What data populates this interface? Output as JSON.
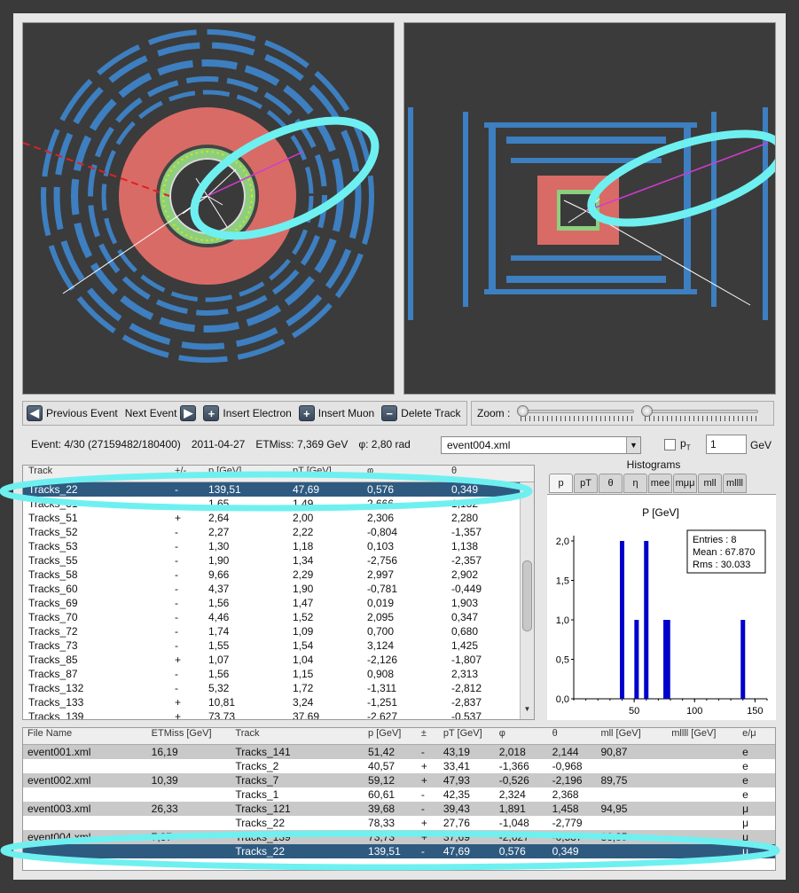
{
  "toolbar": {
    "previous_label": "Previous Event",
    "next_label": "Next Event",
    "insert_electron_label": "Insert Electron",
    "insert_muon_label": "Insert Muon",
    "delete_track_label": "Delete Track",
    "zoom_label": "Zoom :",
    "zoom_levels": [
      0.0,
      0.0
    ]
  },
  "info": {
    "event": "Event: 4/30 (27159482/180400)",
    "date": "2011-04-27",
    "etmiss": "ETMiss: 7,369 GeV",
    "phi": "φ: 2,80 rad",
    "selected_file": "event004.xml",
    "pt_label": "p",
    "pt_sub": "T",
    "pt_value": "1",
    "gev_label": "GeV"
  },
  "tracks_table": {
    "headers": [
      "Track",
      "+/-",
      "p [GeV]",
      "pT [GeV]",
      "φ",
      "θ"
    ],
    "rows": [
      [
        "Tracks_22",
        "-",
        "139,51",
        "47,69",
        "0,576",
        "0,349"
      ],
      [
        "Tracks_31",
        "-",
        "1,65",
        "1,49",
        "2,666",
        "1,132"
      ],
      [
        "Tracks_51",
        "+",
        "2,64",
        "2,00",
        "2,306",
        "2,280"
      ],
      [
        "Tracks_52",
        "-",
        "2,27",
        "2,22",
        "-0,804",
        "-1,357"
      ],
      [
        "Tracks_53",
        "-",
        "1,30",
        "1,18",
        "0,103",
        "1,138"
      ],
      [
        "Tracks_55",
        "-",
        "1,90",
        "1,34",
        "-2,756",
        "-2,357"
      ],
      [
        "Tracks_58",
        "-",
        "9,66",
        "2,29",
        "2,997",
        "2,902"
      ],
      [
        "Tracks_60",
        "-",
        "4,37",
        "1,90",
        "-0,781",
        "-0,449"
      ],
      [
        "Tracks_69",
        "-",
        "1,56",
        "1,47",
        "0,019",
        "1,903"
      ],
      [
        "Tracks_70",
        "-",
        "4,46",
        "1,52",
        "2,095",
        "0,347"
      ],
      [
        "Tracks_72",
        "-",
        "1,74",
        "1,09",
        "0,700",
        "0,680"
      ],
      [
        "Tracks_73",
        "-",
        "1,55",
        "1,54",
        "3,124",
        "1,425"
      ],
      [
        "Tracks_85",
        "+",
        "1,07",
        "1,04",
        "-2,126",
        "-1,807"
      ],
      [
        "Tracks_87",
        "-",
        "1,56",
        "1,15",
        "0,908",
        "2,313"
      ],
      [
        "Tracks_132",
        "-",
        "5,32",
        "1,72",
        "-1,311",
        "-2,812"
      ],
      [
        "Tracks_133",
        "+",
        "10,81",
        "3,24",
        "-1,251",
        "-2,837"
      ],
      [
        "Tracks_139",
        "+",
        "73,73",
        "37,69",
        "-2,627",
        "-0,537"
      ]
    ]
  },
  "histograms": {
    "title": "Histograms",
    "tabs": [
      "p",
      "pT",
      "θ",
      "η",
      "mee",
      "mμμ",
      "mll",
      "mllll"
    ]
  },
  "chart_data": {
    "type": "bar",
    "title": "P [GeV]",
    "xlim": [
      0,
      160
    ],
    "ylim": [
      0,
      2.0
    ],
    "xticks": [
      "50",
      "100",
      "150"
    ],
    "yticks": [
      "0,0",
      "0,5",
      "1,0",
      "1,5",
      "2,0"
    ],
    "bars": [
      {
        "x": 40,
        "y": 2.0
      },
      {
        "x": 52,
        "y": 1.0
      },
      {
        "x": 60,
        "y": 2.0
      },
      {
        "x": 76,
        "y": 1.0
      },
      {
        "x": 78,
        "y": 1.0
      },
      {
        "x": 140,
        "y": 1.0
      }
    ],
    "stats": {
      "entries": "Entries :        8",
      "mean": "Mean : 67.870",
      "rms": "Rms :   30.033"
    },
    "bar_color": "#0000cc"
  },
  "events_table": {
    "headers": [
      "File Name",
      "ETMiss [GeV]",
      "Track",
      "p [GeV]",
      "±",
      "pT [GeV]",
      "φ",
      "θ",
      "mll [GeV]",
      "mllll [GeV]",
      "e/μ"
    ],
    "rows": [
      [
        "event001.xml",
        "16,19",
        "Tracks_141",
        "51,42",
        "-",
        "43,19",
        "2,018",
        "2,144",
        "90,87",
        "",
        "e"
      ],
      [
        "",
        "",
        "Tracks_2",
        "40,57",
        "+",
        "33,41",
        "-1,366",
        "-0,968",
        "",
        "",
        "e"
      ],
      [
        "event002.xml",
        "10,39",
        "Tracks_7",
        "59,12",
        "+",
        "47,93",
        "-0,526",
        "-2,196",
        "89,75",
        "",
        "e"
      ],
      [
        "",
        "",
        "Tracks_1",
        "60,61",
        "-",
        "42,35",
        "2,324",
        "2,368",
        "",
        "",
        "e"
      ],
      [
        "event003.xml",
        "26,33",
        "Tracks_121",
        "39,68",
        "-",
        "39,43",
        "1,891",
        "1,458",
        "94,95",
        "",
        "μ"
      ],
      [
        "",
        "",
        "Tracks_22",
        "78,33",
        "+",
        "27,76",
        "-1,048",
        "-2,779",
        "",
        "",
        "μ"
      ],
      [
        "event004.xml",
        "7,37",
        "Tracks_139",
        "73,73",
        "+",
        "37,69",
        "-2,627",
        "-0,537",
        "86,85",
        "",
        "μ"
      ],
      [
        "",
        "",
        "Tracks_22",
        "139,51",
        "-",
        "47,69",
        "0,576",
        "0,349",
        "",
        "",
        "μ"
      ]
    ]
  },
  "colors": {
    "highlight": "#6ff0f0",
    "selection": "#2e5a80",
    "calo": "#d96b66",
    "detector": "#3d7fc0",
    "tracker": "#8ccf7e"
  }
}
